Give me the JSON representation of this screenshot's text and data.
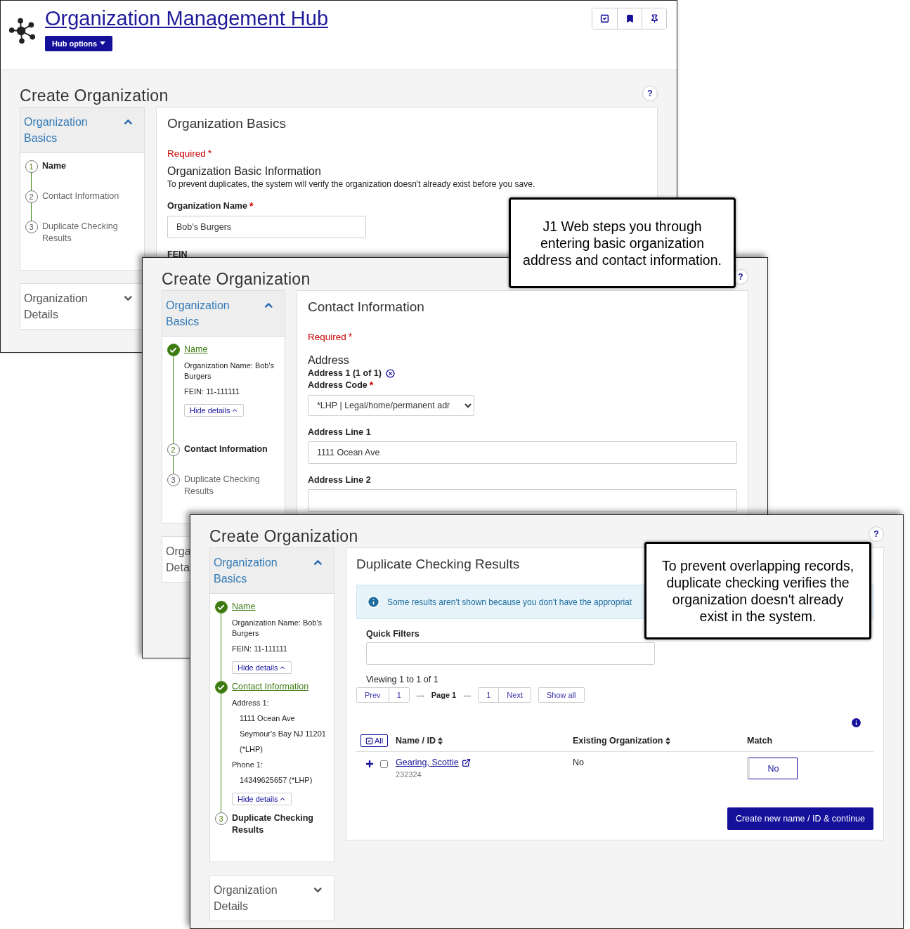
{
  "hub": {
    "title": "Organization Management Hub",
    "options_button": "Hub options"
  },
  "screens": [
    {
      "title": "Create Organization",
      "help": "?",
      "sidebar": [
        {
          "label": "Organization Basics",
          "expanded": true,
          "steps": [
            {
              "number": "1",
              "label": "Name",
              "done": false,
              "current": true
            },
            {
              "number": "2",
              "label": "Contact Information",
              "done": false,
              "current": false
            },
            {
              "number": "3",
              "label": "Duplicate Checking Results",
              "done": false,
              "current": false
            }
          ]
        },
        {
          "label": "Organization Details",
          "expanded": false
        }
      ],
      "panel": {
        "kind": "basics",
        "heading": "Organization Basics",
        "required": "Required",
        "required_mark": "*",
        "section": "Organization Basic Information",
        "note": "To prevent duplicates, the system will verify the organization doesn't already exist before you save.",
        "fields": [
          {
            "kind": "text",
            "label": "Organization Name",
            "required_mark": "*",
            "value": "Bob's Burgers"
          },
          {
            "kind": "label",
            "label": "FEIN"
          }
        ]
      }
    },
    {
      "title": "Create Organization",
      "help": "?",
      "sidebar": [
        {
          "label": "Organization Basics",
          "expanded": true,
          "steps": [
            {
              "label": "Name",
              "done": true,
              "current": false,
              "details": [
                {
                  "text": "Organization Name: Bob's Burgers"
                },
                {
                  "text": "FEIN: 11-111111"
                }
              ],
              "hide_details": "Hide details"
            },
            {
              "number": "2",
              "label": "Contact Information",
              "done": false,
              "current": true
            },
            {
              "number": "3",
              "label": "Duplicate Checking Results",
              "done": false,
              "current": false
            }
          ]
        },
        {
          "label": "Orga",
          "label_2": "Deta"
        }
      ],
      "panel": {
        "kind": "contact",
        "heading": "Contact Information",
        "required": "Required",
        "required_mark": "*",
        "section": "Address",
        "subsection": "Address 1 (1 of 1)",
        "fields": [
          {
            "kind": "select",
            "label": "Address Code",
            "required_mark": "*",
            "value": "*LHP | Legal/home/permanent adr"
          },
          {
            "kind": "text",
            "label": "Address Line 1",
            "value": "1111 Ocean Ave"
          },
          {
            "kind": "text",
            "label": "Address Line 2"
          }
        ]
      }
    },
    {
      "title": "Create Organization",
      "help": "?",
      "sidebar": [
        {
          "label": "Organization Basics",
          "expanded": true,
          "steps": [
            {
              "label": "Name",
              "done": true,
              "current": false,
              "details": [
                {
                  "text": "Organization Name: Bob's Burgers"
                },
                {
                  "text": "FEIN: 11-111111"
                }
              ],
              "hide_details": "Hide details"
            },
            {
              "label": "Contact Information",
              "done": true,
              "current": false,
              "details": [
                {
                  "text": "Address 1:",
                  "children": [
                    {
                      "text": "1111 Ocean Ave"
                    },
                    {
                      "text": "Seymour's Bay NJ 11201"
                    },
                    {
                      "text": "(*LHP)"
                    }
                  ]
                },
                {
                  "text": "Phone 1:",
                  "children": [
                    {
                      "text": "14349625657 (*LHP)"
                    }
                  ]
                }
              ],
              "hide_details": "Hide details"
            },
            {
              "number": "3",
              "label": "Duplicate Checking Results",
              "done": false,
              "current": true
            }
          ]
        },
        {
          "label": "Organization Details",
          "expanded": false
        }
      ],
      "panel": {
        "kind": "duplicates",
        "heading": "Duplicate Checking Results",
        "alert": "Some results aren't shown because you don't have the appropriat",
        "filters_label": "Quick Filters",
        "viewing": "Viewing 1 to 1 of 1",
        "pager": {
          "prev": "Prev",
          "first": "1",
          "gap_1": "---",
          "page": "Page 1",
          "gap_2": "---",
          "last": "1",
          "next": "Next",
          "show_all": "Show all"
        },
        "select_all": "All",
        "columns": [
          {
            "label": "Name / ID",
            "sortable": true
          },
          {
            "label": "Existing Organization",
            "sortable": true
          },
          {
            "label": "Match",
            "sortable": false
          }
        ],
        "rows": [
          {
            "name": "Gearing, Scottie",
            "id": "232324",
            "existing": "No",
            "match": "No",
            "checked": false
          }
        ],
        "continue_button": "Create new name / ID & continue"
      }
    }
  ],
  "callouts": [
    {
      "text": "J1 Web steps you through entering basic organization address and contact information."
    },
    {
      "text": "To prevent overlapping records, duplicate checking verifies the organization doesn't already exist in the system."
    }
  ]
}
